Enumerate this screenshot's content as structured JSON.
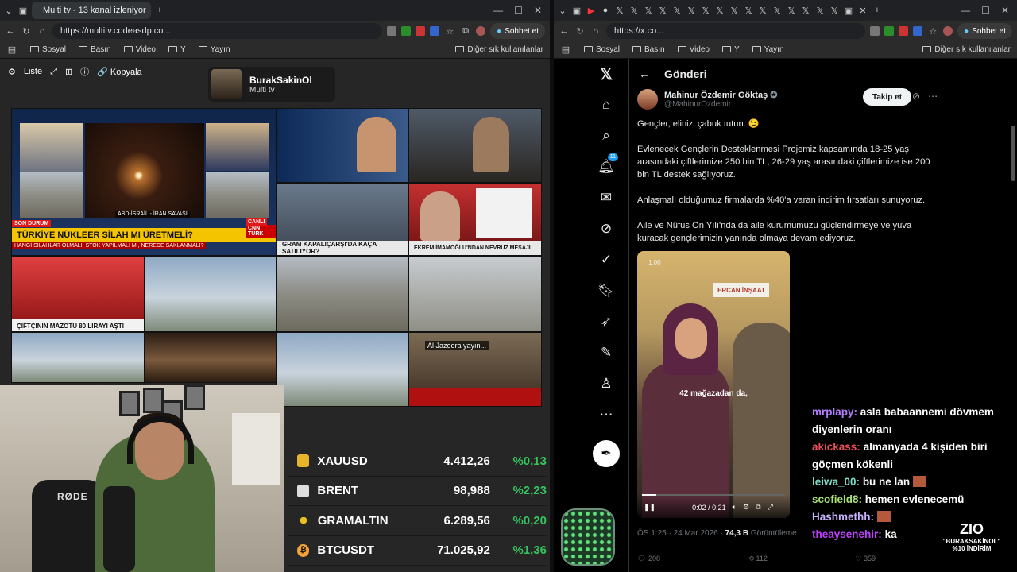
{
  "left_window": {
    "tab_title": "Multi tv - 13 kanal izleniyor",
    "url": "https://multitv.codeasdp.co...",
    "chat_button": "Sohbet et",
    "bookmarks": [
      "Sosyal",
      "Basın",
      "Video",
      "Y",
      "Yayın"
    ],
    "other_bookmarks": "Diğer sık kullanılanlar"
  },
  "multitv": {
    "toolbar": {
      "list_label": "Liste",
      "copy_label": "Kopyala"
    },
    "profile": {
      "name": "BurakSakinOl",
      "subtitle": "Multi tv"
    },
    "tiles": {
      "t1_ticker": "TÜRKİYE NÜKLEER SİLAH MI ÜRETMELİ?",
      "t1_sub": "HANGİ SİLAHLAR OLMALI, STOK YAPILMALI MI, NEREDE SAKLANMALI?",
      "t1_badge": "SON DURUM",
      "t1_channel": "CNN TÜRK",
      "t1_live": "CANLI",
      "t2_ticker": "GRAM KAPALIÇARŞI'DA KAÇA SATILIYOR?",
      "t3_ticker": "EKREM İMAMOĞLU'NDAN NEVRUZ MESAJI",
      "t4_ticker": "ÇİFTÇİNİN MAZOTU 80 LİRAYI AŞTI",
      "t5_caption": "Al Jazeera yayın...",
      "t6_caption": "ABD-İSRAİL - İRAN SAVAŞI"
    }
  },
  "prices": [
    {
      "symbol": "XAUUSD",
      "value": "4.412,26",
      "change": "%0,13",
      "color": "#e8b42a"
    },
    {
      "symbol": "BRENT",
      "value": "98,988",
      "change": "%2,23",
      "color": "#dddddd"
    },
    {
      "symbol": "GRAMALTIN",
      "value": "6.289,56",
      "change": "%0,20",
      "color": "#e8c21f"
    },
    {
      "symbol": "BTCUSDT",
      "value": "71.025,92",
      "change": "%1,36",
      "color": "#f2a23a"
    }
  ],
  "webcam": {
    "mic_brand": "RØDE"
  },
  "right_window": {
    "url": "https://x.co...",
    "chat_button": "Sohbet et",
    "bookmarks": [
      "Sosyal",
      "Basın",
      "Video",
      "Y",
      "Yayın"
    ],
    "other_bookmarks": "Diğer sık kullanılanlar"
  },
  "x": {
    "notifications_count": "11",
    "header_title": "Gönderi",
    "author_name": "Mahinur Özdemir Göktaş",
    "author_handle": "@MahinurOzdemir",
    "follow_label": "Takip et",
    "paragraphs": [
      "Gençler, elinizi çabuk tutun. 😉",
      "Evlenecek Gençlerin Desteklenmesi Projemiz kapsamında 18-25 yaş arasındaki çiftlerimize 250 bin TL, 26-29 yaş arasındaki çiftlerimize ise 200 bin TL destek sağlıyoruz.",
      "Anlaşmalı olduğumuz firmalarda %40'a varan indirim fırsatları sunuyoruz.",
      "Aile ve Nüfus On Yılı'nda da aile kurumumuzu güçlendirmeye ve yuva kuracak gençlerimizin yanında olmaya devam ediyoruz."
    ],
    "video": {
      "subtitle": "42 mağazadan da,",
      "time": "0:02 / 0:21",
      "sign": "ERCAN İNŞAAT",
      "top_label": "1.00",
      "progress": 0.1
    },
    "meta_time": "ÖS 1:25 · 24 Mar 2026 · ",
    "meta_views": "74,3 B",
    "meta_views_label": " Görüntüleme",
    "replies": "208",
    "reposts": "112",
    "likes": "359"
  },
  "chat": [
    {
      "user": "mrplapy:",
      "msg": "asla babaannemi dövmem diyenlerin oranı",
      "color": "#b47cff"
    },
    {
      "user": "akickass:",
      "msg": "almanyada 4 kişiden biri göçmen kökenli",
      "color": "#e8505a"
    },
    {
      "user": "leiwa_00:",
      "msg": "bu ne lan",
      "color": "#7ed9c4"
    },
    {
      "user": "scofield8:",
      "msg": "hemen evlenecemü",
      "color": "#a8e07a"
    },
    {
      "user": "Hashmethh:",
      "msg": "",
      "color": "#c8b4ff"
    },
    {
      "user": "theaysenehir:",
      "msg": "ka",
      "color": "#c040ff"
    }
  ],
  "zio": {
    "logo": "ZIO",
    "line1": "\"BURAKSAKİNOL\"",
    "line2": "%10 İNDİRİM"
  }
}
